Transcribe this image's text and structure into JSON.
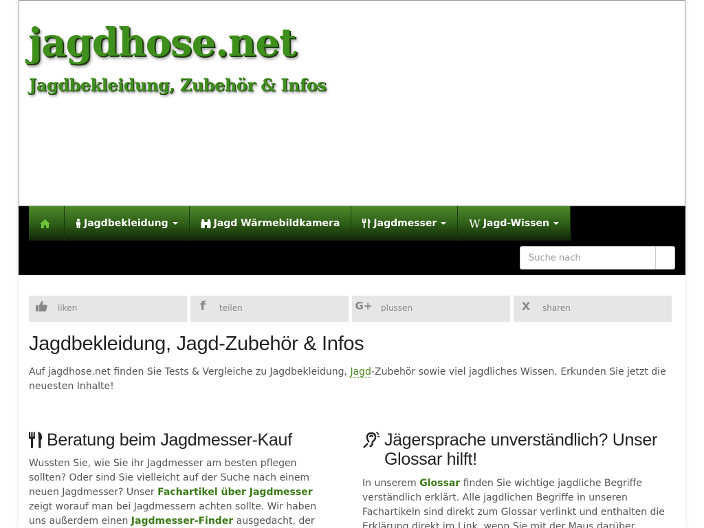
{
  "header": {
    "logo_title": "jagdhose.net",
    "logo_subtitle": "Jagdbekleidung, Zubehör & Infos"
  },
  "nav": {
    "items": [
      {
        "label": "",
        "icon": "home-icon",
        "dropdown": false
      },
      {
        "label": "Jagdbekleidung",
        "icon": "male-icon",
        "dropdown": true
      },
      {
        "label": "Jagd Wärmebildkamera",
        "icon": "binoculars-icon",
        "dropdown": false
      },
      {
        "label": "Jagdmesser",
        "icon": "cutlery-icon",
        "dropdown": true
      },
      {
        "label": "Jagd-Wissen",
        "icon": "wikipedia-icon",
        "dropdown": true
      }
    ],
    "wiki_glyph": "W"
  },
  "search": {
    "placeholder": "Suche nach"
  },
  "share": [
    {
      "label": "liken",
      "icon": "thumbs-up-icon"
    },
    {
      "label": "teilen",
      "icon": "facebook-icon",
      "glyph": "f"
    },
    {
      "label": "plussen",
      "icon": "google-plus-icon",
      "glyph": "G+"
    },
    {
      "label": "sharen",
      "icon": "xing-icon",
      "glyph": "X"
    }
  ],
  "main": {
    "title": "Jagdbekleidung, Jagd-Zubehör & Infos",
    "intro_before": "Auf jagdhose.net finden Sie Tests & Vergleiche zu Jagdbekleidung, ",
    "intro_link": "Jagd",
    "intro_after": "-Zubehör sowie viel jagdliches Wissen. Erkunden Sie jetzt die neuesten Inhalte!"
  },
  "sections": {
    "left": {
      "title": "Beratung beim Jagdmesser-Kauf",
      "icon": "cutlery-icon",
      "text_1": "Wussten Sie, wie Sie ihr Jagdmesser am besten pflegen sollten? Oder sind Sie vielleicht auf der Suche nach einem neuen Jagdmesser? Unser ",
      "link_1": "Fachartikel über Jagdmesser",
      "text_2": " zeigt worauf man bei Jagdmessern achten sollte. Wir haben uns außerdem einen ",
      "link_2": "Jagdmesser-Finder",
      "text_3": " ausgedacht, der Ihnen alle wichtigen"
    },
    "right": {
      "title": "Jägersprache unverständlich? Unser Glossar hilft!",
      "icon": "assistive-listening-icon",
      "text_1": "In unserem ",
      "link_1": "Glossar",
      "text_2": " finden Sie wichtige jagdliche Begriffe verständlich erklärt. Alle jagdlichen Begriffe in unseren Fachartikeln sind direkt zum Glossar verlinkt und enthalten die Erklärung direkt im Link, wenn Sie mit der Maus darüber"
    }
  },
  "colors": {
    "brand_green": "#3f8f1d",
    "nav_black": "#000000",
    "link_green": "#3a7a17",
    "share_bg": "#e6e6e6"
  }
}
